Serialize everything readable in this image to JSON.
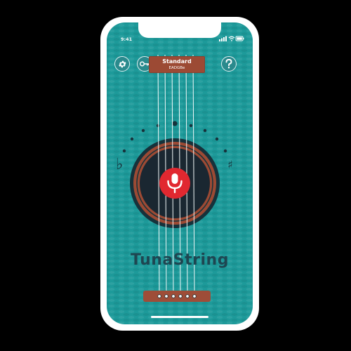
{
  "status_bar": {
    "time": "9:41"
  },
  "header": {
    "tuning_name": "Standard",
    "tuning_notes": "EADGBe"
  },
  "symbols": {
    "flat": "♭",
    "sharp": "♯"
  },
  "app_name": "TunaString",
  "colors": {
    "background": "#1d9a9a",
    "wood": "#9c4a34",
    "dark": "#16323b",
    "record_button": "#e12830"
  },
  "icons": {
    "settings": "gear-icon",
    "tuning": "key-icon",
    "help": "question-mark-icon",
    "record": "microphone-icon"
  }
}
